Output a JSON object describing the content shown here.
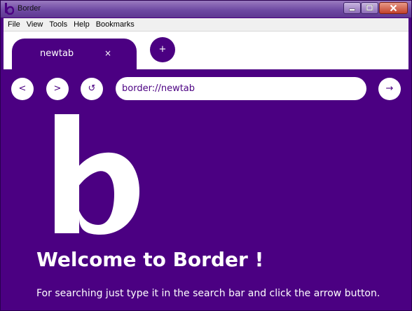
{
  "window": {
    "title": "Border",
    "controls": {
      "minimize": "minimize",
      "maximize": "maximize",
      "close": "close"
    }
  },
  "menubar": {
    "items": [
      "File",
      "View",
      "Tools",
      "Help",
      "Bookmarks"
    ]
  },
  "tabs": [
    {
      "label": "newtab",
      "close": "×"
    }
  ],
  "new_tab_button": "+",
  "nav": {
    "back": "<",
    "forward": ">",
    "reload": "↺",
    "go": "→",
    "url": "border://newtab"
  },
  "page": {
    "heading": "Welcome to Border !",
    "hint": "For searching just type it in the search bar and click the arrow button."
  },
  "icons": {
    "app": "border-logo-icon",
    "logo": "border-b-logo",
    "back": "back-arrow-icon",
    "forward": "forward-arrow-icon",
    "reload": "reload-icon",
    "go": "go-arrow-icon",
    "new_tab": "plus-icon",
    "tab_close": "close-icon"
  },
  "colors": {
    "brand": "#4b0082",
    "surface": "#ffffff",
    "titlebar": "#6f4aa3"
  }
}
